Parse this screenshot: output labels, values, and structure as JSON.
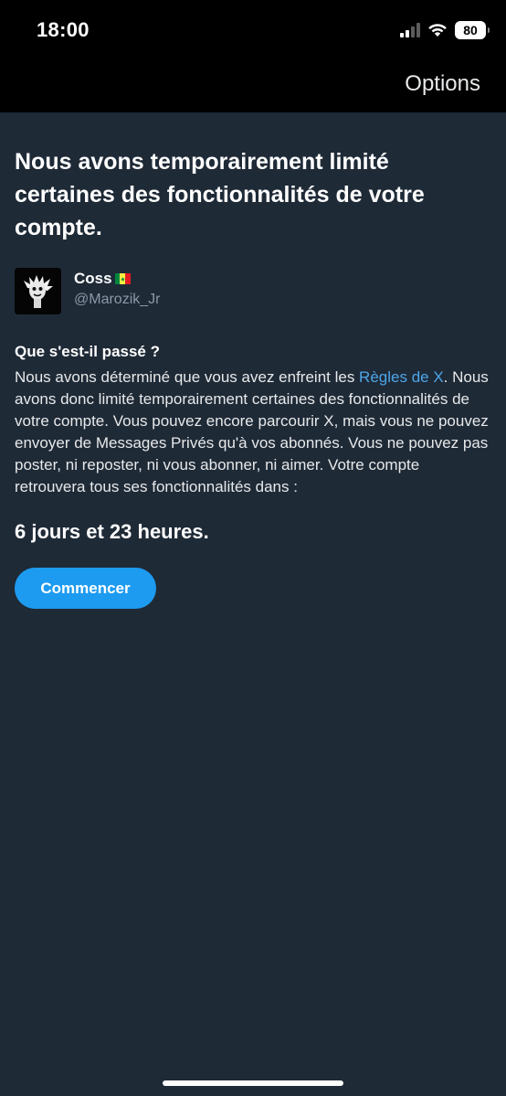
{
  "status_bar": {
    "time": "18:00",
    "battery_level": "80",
    "icons": [
      "cellular-signal-icon",
      "wifi-icon",
      "battery-icon"
    ]
  },
  "nav": {
    "options_label": "Options"
  },
  "notice": {
    "headline": "Nous avons temporairement limité certaines des fonctionnalités de votre compte."
  },
  "profile": {
    "display_name": "Coss",
    "flag": "Senegal flag",
    "handle": "@Marozik_Jr"
  },
  "details": {
    "title": "Que s'est-il passé ?",
    "text_before_link": "Nous avons déterminé que vous avez enfreint les ",
    "link_label": "Règles de X",
    "text_after_link": ". Nous avons donc limité temporairement certaines des fonctionnalités de votre compte. Vous pouvez encore parcourir X, mais vous ne pouvez envoyer de Messages Privés qu'à vos abonnés. Vous ne pouvez pas poster, ni reposter, ni vous abonner, ni aimer. Votre compte retrouvera tous ses fonctionnalités dans :",
    "countdown": "6 jours et 23 heures."
  },
  "actions": {
    "start_label": "Commencer"
  },
  "colors": {
    "background": "#1f2a37",
    "header_background": "#000000",
    "accent": "#1d9bf0",
    "link": "#4da6e8",
    "secondary_text": "#8b98a5"
  }
}
